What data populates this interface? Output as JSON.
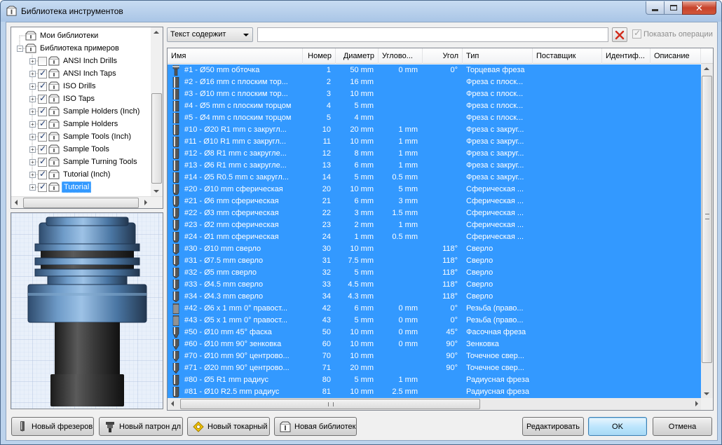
{
  "window": {
    "title": "Библиотека инструментов"
  },
  "tree": {
    "items": [
      {
        "label": "Мои библиотеки",
        "level": 1,
        "checkbox": false,
        "expander": false,
        "selected": false
      },
      {
        "label": "Библиотека примеров",
        "level": 1,
        "checkbox": false,
        "expander": "minus",
        "selected": false
      },
      {
        "label": "ANSI Inch Drills",
        "level": 2,
        "checkbox": "unchecked",
        "expander": "plus",
        "selected": false
      },
      {
        "label": "ANSI Inch Taps",
        "level": 2,
        "checkbox": "checked",
        "expander": "plus",
        "selected": false
      },
      {
        "label": "ISO Drills",
        "level": 2,
        "checkbox": "checked",
        "expander": "plus",
        "selected": false
      },
      {
        "label": "ISO Taps",
        "level": 2,
        "checkbox": "checked",
        "expander": "plus",
        "selected": false
      },
      {
        "label": "Sample Holders (Inch)",
        "level": 2,
        "checkbox": "checked",
        "expander": "plus",
        "selected": false
      },
      {
        "label": "Sample Holders",
        "level": 2,
        "checkbox": "checked",
        "expander": "plus",
        "selected": false
      },
      {
        "label": "Sample Tools (Inch)",
        "level": 2,
        "checkbox": "checked",
        "expander": "plus",
        "selected": false
      },
      {
        "label": "Sample Tools",
        "level": 2,
        "checkbox": "checked",
        "expander": "plus",
        "selected": false
      },
      {
        "label": "Sample Turning Tools",
        "level": 2,
        "checkbox": "checked",
        "expander": "plus",
        "selected": false
      },
      {
        "label": "Tutorial (Inch)",
        "level": 2,
        "checkbox": "checked",
        "expander": "plus",
        "selected": false
      },
      {
        "label": "Tutorial",
        "level": 2,
        "checkbox": "checked",
        "expander": "plus",
        "selected": true
      }
    ]
  },
  "toolbar": {
    "filter_mode": "Текст содержит",
    "search_value": "",
    "show_operations_label": "Показать операции"
  },
  "table": {
    "columns": [
      "Имя",
      "Номер",
      "Диаметр",
      "Угловой радиус",
      "Угол",
      "Тип",
      "Поставщик",
      "Идентификатор",
      "Описание"
    ],
    "columns_display": [
      "Имя",
      "Номер",
      "Диаметр",
      "Углово...",
      "Угол",
      "Тип",
      "Поставщик",
      "Идентиф...",
      "Описание"
    ],
    "rows": [
      {
        "icon": "turning-tool",
        "name": "#1 - Ø50 mm обточка",
        "number": "1",
        "diameter": "50 mm",
        "radius": "0 mm",
        "angle": "0°",
        "type": "Торцевая фреза"
      },
      {
        "icon": "flat-mill",
        "name": "#2 - Ø16 mm с плоским тор...",
        "number": "2",
        "diameter": "16 mm",
        "radius": "",
        "angle": "",
        "type": "Фреза с плоск..."
      },
      {
        "icon": "flat-mill",
        "name": "#3 - Ø10 mm с плоским тор...",
        "number": "3",
        "diameter": "10 mm",
        "radius": "",
        "angle": "",
        "type": "Фреза с плоск..."
      },
      {
        "icon": "flat-mill",
        "name": "#4 - Ø5 mm с плоским торцом",
        "number": "4",
        "diameter": "5 mm",
        "radius": "",
        "angle": "",
        "type": "Фреза с плоск..."
      },
      {
        "icon": "flat-mill",
        "name": "#5 - Ø4 mm с плоским торцом",
        "number": "5",
        "diameter": "4 mm",
        "radius": "",
        "angle": "",
        "type": "Фреза с плоск..."
      },
      {
        "icon": "bull-mill",
        "name": "#10 - Ø20 R1 mm с закругл...",
        "number": "10",
        "diameter": "20 mm",
        "radius": "1 mm",
        "angle": "",
        "type": "Фреза с закруг..."
      },
      {
        "icon": "bull-mill",
        "name": "#11 - Ø10 R1 mm с закругл...",
        "number": "11",
        "diameter": "10 mm",
        "radius": "1 mm",
        "angle": "",
        "type": "Фреза с закруг..."
      },
      {
        "icon": "bull-mill",
        "name": "#12 - Ø8 R1 mm с закругле...",
        "number": "12",
        "diameter": "8 mm",
        "radius": "1 mm",
        "angle": "",
        "type": "Фреза с закруг..."
      },
      {
        "icon": "bull-mill",
        "name": "#13 - Ø6 R1 mm с закругле...",
        "number": "13",
        "diameter": "6 mm",
        "radius": "1 mm",
        "angle": "",
        "type": "Фреза с закруг..."
      },
      {
        "icon": "bull-mill",
        "name": "#14 - Ø5 R0.5 mm с закругл...",
        "number": "14",
        "diameter": "5 mm",
        "radius": "0.5 mm",
        "angle": "",
        "type": "Фреза с закруг..."
      },
      {
        "icon": "ball-mill",
        "name": "#20 - Ø10 mm сферическая",
        "number": "20",
        "diameter": "10 mm",
        "radius": "5 mm",
        "angle": "",
        "type": "Сферическая ..."
      },
      {
        "icon": "ball-mill",
        "name": "#21 - Ø6 mm сферическая",
        "number": "21",
        "diameter": "6 mm",
        "radius": "3 mm",
        "angle": "",
        "type": "Сферическая ..."
      },
      {
        "icon": "ball-mill",
        "name": "#22 - Ø3 mm сферическая",
        "number": "22",
        "diameter": "3 mm",
        "radius": "1.5 mm",
        "angle": "",
        "type": "Сферическая ..."
      },
      {
        "icon": "ball-mill",
        "name": "#23 - Ø2 mm сферическая",
        "number": "23",
        "diameter": "2 mm",
        "radius": "1 mm",
        "angle": "",
        "type": "Сферическая ..."
      },
      {
        "icon": "ball-mill",
        "name": "#24 - Ø1 mm сферическая",
        "number": "24",
        "diameter": "1 mm",
        "radius": "0.5 mm",
        "angle": "",
        "type": "Сферическая ..."
      },
      {
        "icon": "drill",
        "name": "#30 - Ø10 mm сверло",
        "number": "30",
        "diameter": "10 mm",
        "radius": "",
        "angle": "118°",
        "type": "Сверло"
      },
      {
        "icon": "drill",
        "name": "#31 - Ø7.5 mm сверло",
        "number": "31",
        "diameter": "7.5 mm",
        "radius": "",
        "angle": "118°",
        "type": "Сверло"
      },
      {
        "icon": "drill",
        "name": "#32 - Ø5 mm сверло",
        "number": "32",
        "diameter": "5 mm",
        "radius": "",
        "angle": "118°",
        "type": "Сверло"
      },
      {
        "icon": "drill",
        "name": "#33 - Ø4.5 mm сверло",
        "number": "33",
        "diameter": "4.5 mm",
        "radius": "",
        "angle": "118°",
        "type": "Сверло"
      },
      {
        "icon": "drill",
        "name": "#34 - Ø4.3 mm сверло",
        "number": "34",
        "diameter": "4.3 mm",
        "radius": "",
        "angle": "118°",
        "type": "Сверло"
      },
      {
        "icon": "tap",
        "name": "#42 - Ø6 x 1 mm 0° правост...",
        "number": "42",
        "diameter": "6 mm",
        "radius": "0 mm",
        "angle": "0°",
        "type": "Резьба (право..."
      },
      {
        "icon": "tap",
        "name": "#43 - Ø5 x 1 mm 0° правост...",
        "number": "43",
        "diameter": "5 mm",
        "radius": "0 mm",
        "angle": "0°",
        "type": "Резьба (право..."
      },
      {
        "icon": "chamfer-mill",
        "name": "#50 - Ø10 mm 45° фаска",
        "number": "50",
        "diameter": "10 mm",
        "radius": "0 mm",
        "angle": "45°",
        "type": "Фасочная фреза"
      },
      {
        "icon": "countersink",
        "name": "#60 - Ø10 mm 90° зенковка",
        "number": "60",
        "diameter": "10 mm",
        "radius": "0 mm",
        "angle": "90°",
        "type": "Зенковка"
      },
      {
        "icon": "spot-drill",
        "name": "#70 - Ø10 mm 90° центрово...",
        "number": "70",
        "diameter": "10 mm",
        "radius": "",
        "angle": "90°",
        "type": "Точечное свер..."
      },
      {
        "icon": "spot-drill",
        "name": "#71 - Ø20 mm 90° центрово...",
        "number": "71",
        "diameter": "20 mm",
        "radius": "",
        "angle": "90°",
        "type": "Точечное свер..."
      },
      {
        "icon": "radius-mill",
        "name": "#80 - Ø5 R1 mm радиус",
        "number": "80",
        "diameter": "5 mm",
        "radius": "1 mm",
        "angle": "",
        "type": "Радиусная фреза"
      },
      {
        "icon": "radius-mill",
        "name": "#81 - Ø10 R2.5 mm радиус",
        "number": "81",
        "diameter": "10 mm",
        "radius": "2.5 mm",
        "angle": "",
        "type": "Радиусная фреза"
      }
    ]
  },
  "buttons": {
    "new_mill": "Новый фрезеров",
    "new_holder": "Новый патрон дл",
    "new_turning": "Новый токарный",
    "new_library": "Новая библиотек",
    "edit": "Редактировать",
    "ok": "OK",
    "cancel": "Отмена"
  },
  "colors": {
    "selection": "#3399ff",
    "title_bar": "#bcd3ec",
    "close_button": "#c7432b"
  }
}
